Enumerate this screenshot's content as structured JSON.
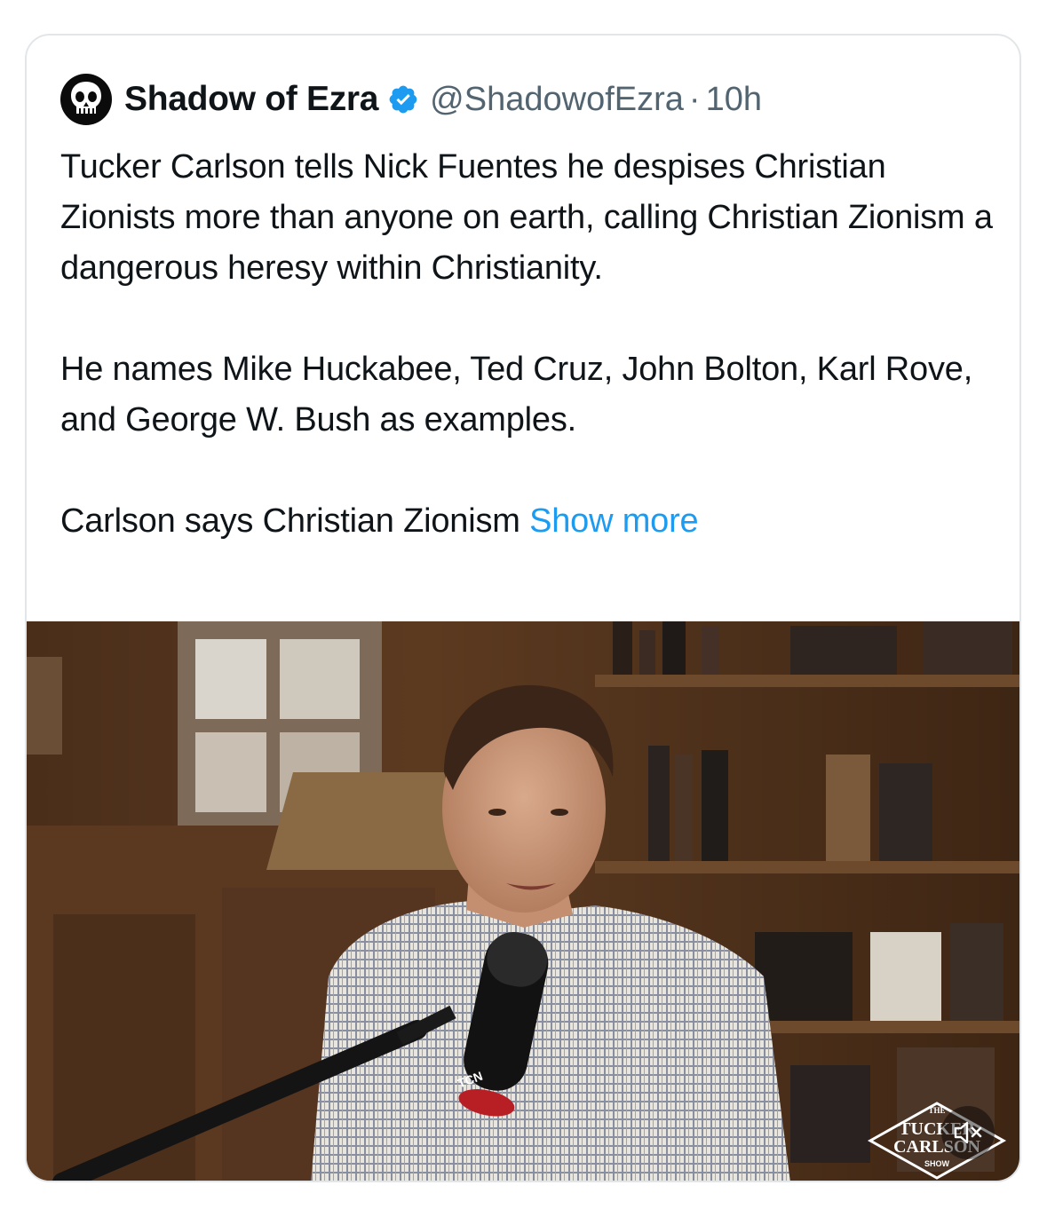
{
  "tweet": {
    "display_name": "Shadow of Ezra",
    "handle": "@ShadowofEzra",
    "separator": "·",
    "time": "10h",
    "paragraphs": [
      "Tucker Carlson tells Nick Fuentes he despises Christian Zionists more than anyone on earth, calling Christian Zionism a dangerous heresy within Christianity.",
      "He names Mike Huckabee, Ted Cruz, John Bolton, Karl Rove, and George W. Bush as examples."
    ],
    "truncated_text": "Carlson says Christian Zionism",
    "show_more_label": "Show more"
  },
  "media": {
    "type": "video",
    "mic_brand": "TCN",
    "watermark": {
      "line1": "THE",
      "line2": "TUCKER",
      "line3": "CARLSON",
      "line4": "SHOW"
    },
    "mute_icon": "speaker-muted-icon"
  },
  "colors": {
    "accent": "#1d9bf0",
    "text": "#0f1419",
    "secondary": "#536471",
    "border": "#e3e6e8"
  }
}
